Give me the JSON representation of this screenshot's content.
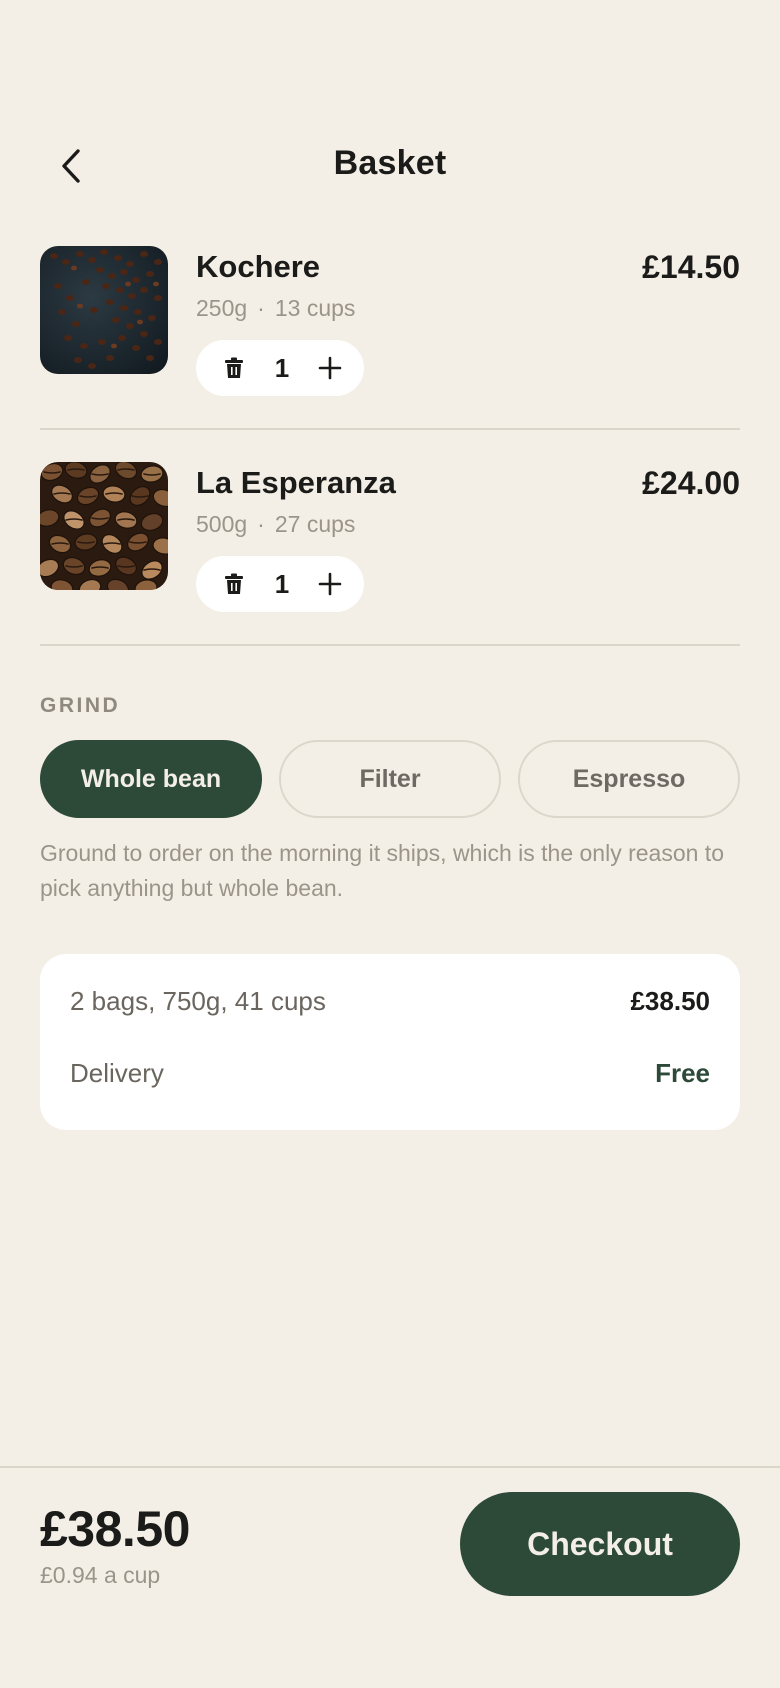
{
  "header": {
    "title": "Basket",
    "back_icon": "chevron-left-icon"
  },
  "items": [
    {
      "name": "Kochere",
      "weight": "250g",
      "cups": "13 cups",
      "price": "£14.50",
      "quantity": "1",
      "image": "dark roasted beans scattered on dark surface"
    },
    {
      "name": "La Esperanza",
      "weight": "500g",
      "cups": "27 cups",
      "price": "£24.00",
      "quantity": "1",
      "image": "pile of roasted coffee beans"
    }
  ],
  "grind": {
    "label": "GRIND",
    "options": [
      "Whole bean",
      "Filter",
      "Espresso"
    ],
    "selected": "Whole bean",
    "note": "Ground to order on the morning it ships, which is the only reason to pick anything but whole bean."
  },
  "summary": {
    "items_label": "2 bags, 750g, 41 cups",
    "items_price": "£38.50",
    "delivery_label": "Delivery",
    "delivery_price": "Free"
  },
  "footer": {
    "total": "£38.50",
    "per_cup": "£0.94 a cup",
    "checkout_label": "Checkout"
  },
  "colors": {
    "background": "#f4efe6",
    "accent": "#2d4a39",
    "card": "#ffffff",
    "muted_text": "#9a948a"
  }
}
